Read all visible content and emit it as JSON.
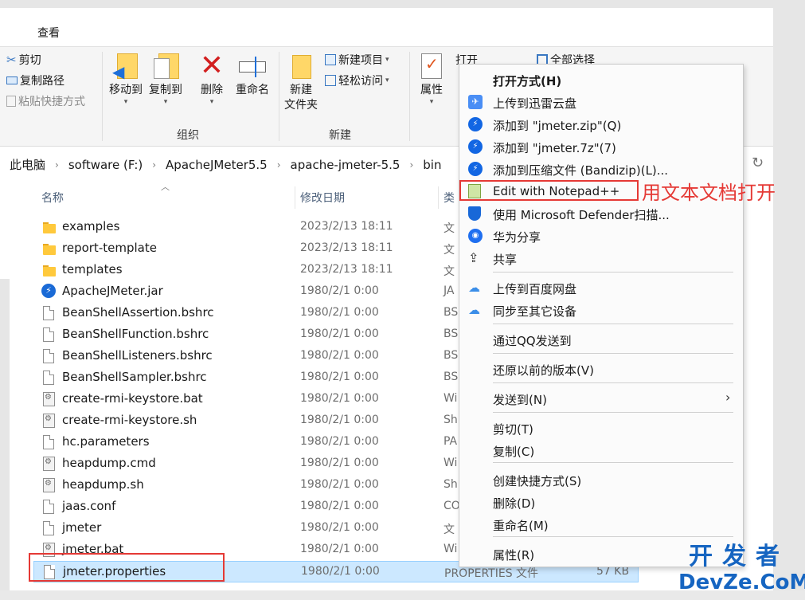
{
  "ribbon": {
    "tab": "查看",
    "clipboard": {
      "cut": "剪切",
      "copy_path": "复制路径",
      "paste_shortcut": "粘贴快捷方式"
    },
    "organize": {
      "move_to": "移动到",
      "copy_to": "复制到",
      "delete": "删除",
      "rename": "重命名",
      "group": "组织"
    },
    "new": {
      "new_folder_line1": "新建",
      "new_folder_line2": "文件夹",
      "new_item": "新建项目",
      "easy_access": "轻松访问",
      "group": "新建"
    },
    "open": {
      "properties": "属性",
      "open": "打开",
      "select_all": "全部选择"
    }
  },
  "breadcrumb": [
    "此电脑",
    "software (F:)",
    "ApacheJMeter5.5",
    "apache-jmeter-5.5",
    "bin"
  ],
  "columns": {
    "name": "名称",
    "modified": "修改日期",
    "type": "类"
  },
  "files": [
    {
      "name": "examples",
      "date": "2023/2/13 18:11",
      "type": "文",
      "icon": "folder-icon"
    },
    {
      "name": "report-template",
      "date": "2023/2/13 18:11",
      "type": "文",
      "icon": "folder-icon"
    },
    {
      "name": "templates",
      "date": "2023/2/13 18:11",
      "type": "文",
      "icon": "folder-icon"
    },
    {
      "name": "ApacheJMeter.jar",
      "date": "1980/2/1 0:00",
      "type": "JA",
      "icon": "jar-icon"
    },
    {
      "name": "BeanShellAssertion.bshrc",
      "date": "1980/2/1 0:00",
      "type": "BS",
      "icon": "file-icon"
    },
    {
      "name": "BeanShellFunction.bshrc",
      "date": "1980/2/1 0:00",
      "type": "BS",
      "icon": "file-icon"
    },
    {
      "name": "BeanShellListeners.bshrc",
      "date": "1980/2/1 0:00",
      "type": "BS",
      "icon": "file-icon"
    },
    {
      "name": "BeanShellSampler.bshrc",
      "date": "1980/2/1 0:00",
      "type": "BS",
      "icon": "file-icon"
    },
    {
      "name": "create-rmi-keystore.bat",
      "date": "1980/2/1 0:00",
      "type": "Wi",
      "icon": "script-icon"
    },
    {
      "name": "create-rmi-keystore.sh",
      "date": "1980/2/1 0:00",
      "type": "Sh",
      "icon": "script-icon"
    },
    {
      "name": "hc.parameters",
      "date": "1980/2/1 0:00",
      "type": "PA",
      "icon": "file-icon"
    },
    {
      "name": "heapdump.cmd",
      "date": "1980/2/1 0:00",
      "type": "Wi",
      "icon": "script-icon"
    },
    {
      "name": "heapdump.sh",
      "date": "1980/2/1 0:00",
      "type": "Sh",
      "icon": "script-icon"
    },
    {
      "name": "jaas.conf",
      "date": "1980/2/1 0:00",
      "type": "CO",
      "icon": "file-icon"
    },
    {
      "name": "jmeter",
      "date": "1980/2/1 0:00",
      "type": "文",
      "icon": "file-icon"
    },
    {
      "name": "jmeter.bat",
      "date": "1980/2/1 0:00",
      "type": "Wi",
      "icon": "script-icon"
    },
    {
      "name": "jmeter.properties",
      "date": "1980/2/1 0:00",
      "type": "PROPERTIES 文件",
      "size": "57 KB",
      "icon": "file-icon",
      "selected": true
    }
  ],
  "context_menu": {
    "items": [
      {
        "label": "打开方式(H)",
        "icon": "",
        "bold": true
      },
      {
        "label": "上传到迅雷云盘",
        "icon": "thunder-icon"
      },
      {
        "label": "添加到 \"jmeter.zip\"(Q)",
        "icon": "bandizip-icon"
      },
      {
        "label": "添加到 \"jmeter.7z\"(7)",
        "icon": "bandizip-icon"
      },
      {
        "label": "添加到压缩文件 (Bandizip)(L)...",
        "icon": "bandizip-icon"
      },
      {
        "label": "Edit with Notepad++",
        "icon": "notepad-plus-icon"
      },
      {
        "label": "使用 Microsoft Defender扫描...",
        "icon": "defender-shield-icon"
      },
      {
        "label": "华为分享",
        "icon": "huawei-share-icon"
      },
      {
        "label": "共享",
        "icon": "share-icon"
      },
      {
        "label": "上传到百度网盘",
        "icon": "baidu-cloud-icon"
      },
      {
        "label": "同步至其它设备",
        "icon": "baidu-cloud-icon"
      },
      {
        "label": "通过QQ发送到",
        "icon": ""
      },
      {
        "label": "还原以前的版本(V)",
        "icon": ""
      },
      {
        "label": "发送到(N)",
        "icon": ""
      },
      {
        "label": "剪切(T)",
        "icon": ""
      },
      {
        "label": "复制(C)",
        "icon": ""
      },
      {
        "label": "创建快捷方式(S)",
        "icon": ""
      },
      {
        "label": "删除(D)",
        "icon": ""
      },
      {
        "label": "重命名(M)",
        "icon": ""
      },
      {
        "label": "属性(R)",
        "icon": ""
      }
    ]
  },
  "annotation": "用文本文档打开",
  "watermark": {
    "top": "开发者",
    "bottom": "DevZe.CoM"
  },
  "colors": {
    "accent": "#e53935",
    "selection": "#cce8ff",
    "watermark": "#1665c1"
  }
}
